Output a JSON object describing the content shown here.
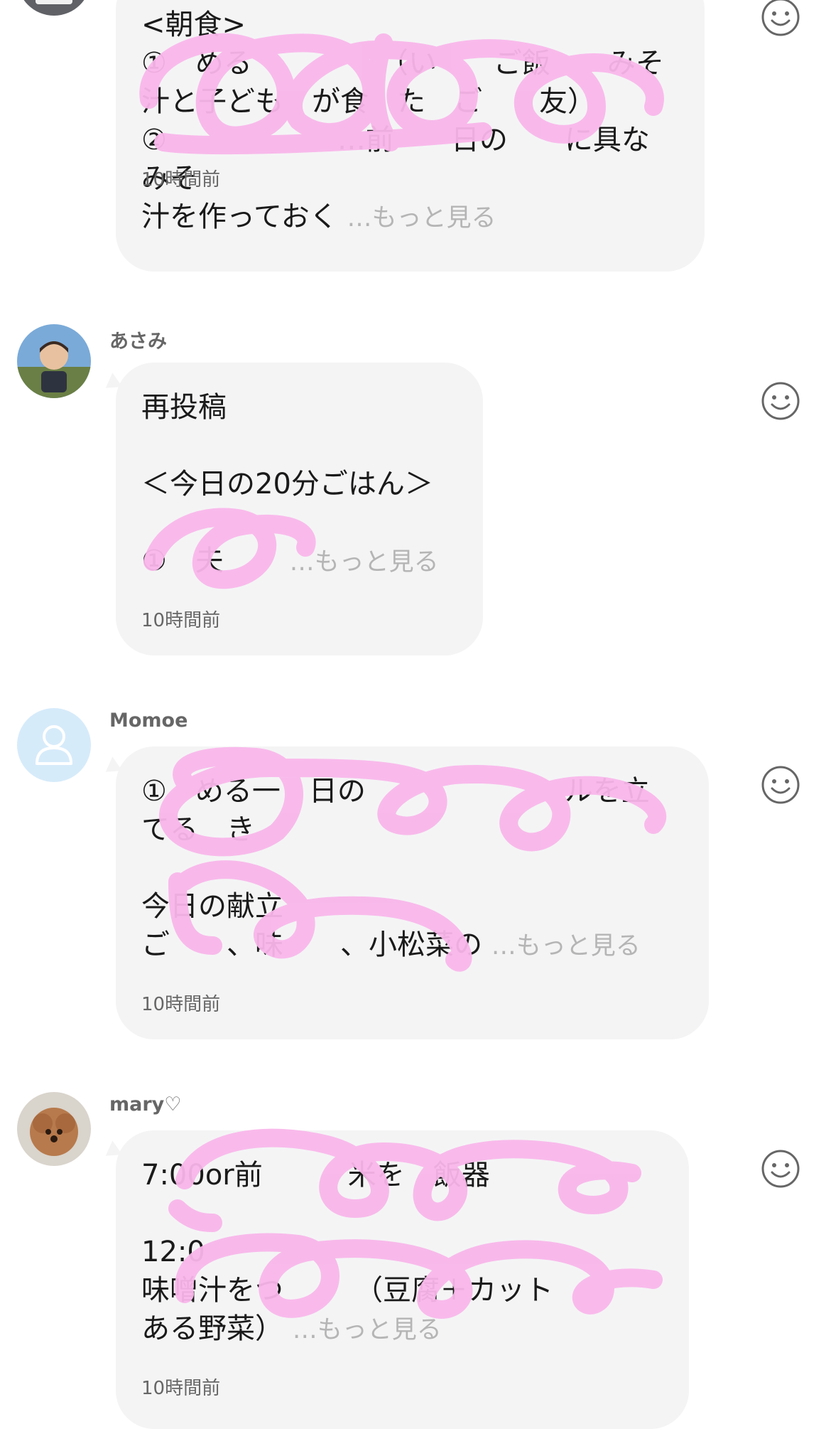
{
  "colors": {
    "bubble_bg": "#f4f4f5",
    "scribble": "#f9b6ea",
    "more_link": "#b5b5b5",
    "timestamp": "#666666"
  },
  "messages": [
    {
      "username": "",
      "text": "<朝食>\n①　める　　　　　（い　　ご飯　　みそ\n汁と子ども　が食　た　ご　　友）\n②　　　　　　…前　　日の　　に具な　みそ\n汁を作っておく",
      "more": "…もっと見る",
      "time": "10時間前",
      "reaction_icon": "smiley-icon"
    },
    {
      "username": "あさみ",
      "text": "再投稿\n\n＜今日の20分ごはん＞\n\n①　夫　　",
      "more": "…もっと見る",
      "time": "10時間前",
      "reaction_icon": "smiley-icon"
    },
    {
      "username": "Momoe",
      "text": "①　める一　日の　　　　　　　ルを立\nてる　き\n\n今日の献立\nご　　、味　　、小松菜の",
      "more": "…もっと見る",
      "time": "10時間前",
      "reaction_icon": "smiley-icon"
    },
    {
      "username": "mary♡",
      "text": "7:00or前　　　米を　飯器　　　　\n\n12:0　\n味噌汁をつ　　　（豆腐＋カット　　　ある野菜）",
      "more": "…もっと見る",
      "time": "10時間前",
      "reaction_icon": "smiley-icon"
    }
  ]
}
